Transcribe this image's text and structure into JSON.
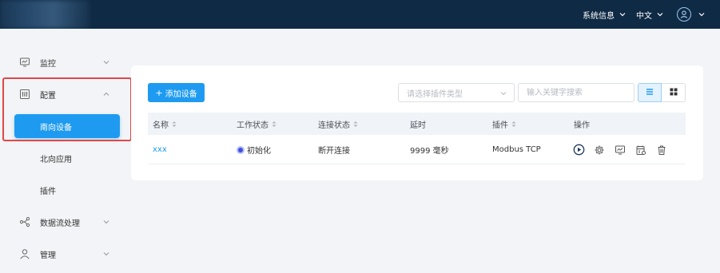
{
  "topbar": {
    "system_info": "系统信息",
    "language": "中文"
  },
  "sidebar": {
    "items": [
      {
        "label": "监控",
        "icon": "monitor-icon"
      },
      {
        "label": "配置",
        "icon": "config-icon"
      },
      {
        "label": "插件"
      },
      {
        "label": "数据流处理",
        "icon": "dataflow-icon"
      },
      {
        "label": "管理",
        "icon": "user-icon"
      }
    ],
    "config_sub": [
      {
        "label": "南向设备",
        "active": true
      },
      {
        "label": "北向应用",
        "active": false
      }
    ]
  },
  "toolbar": {
    "add_label": "添加设备",
    "plugin_select_placeholder": "请选择插件类型",
    "search_placeholder": "输入关键字搜索"
  },
  "table": {
    "headers": [
      "名称",
      "工作状态",
      "连接状态",
      "延时",
      "插件",
      "操作"
    ],
    "rows": [
      {
        "name": "xxx",
        "work_status": "初始化",
        "conn_status": "断开连接",
        "delay": "9999 毫秒",
        "plugin": "Modbus TCP"
      }
    ]
  },
  "colors": {
    "topbar": "#0f2a44",
    "accent": "#1e9bf0",
    "highlight": "#e04848",
    "status_init": "#3f51d8"
  }
}
